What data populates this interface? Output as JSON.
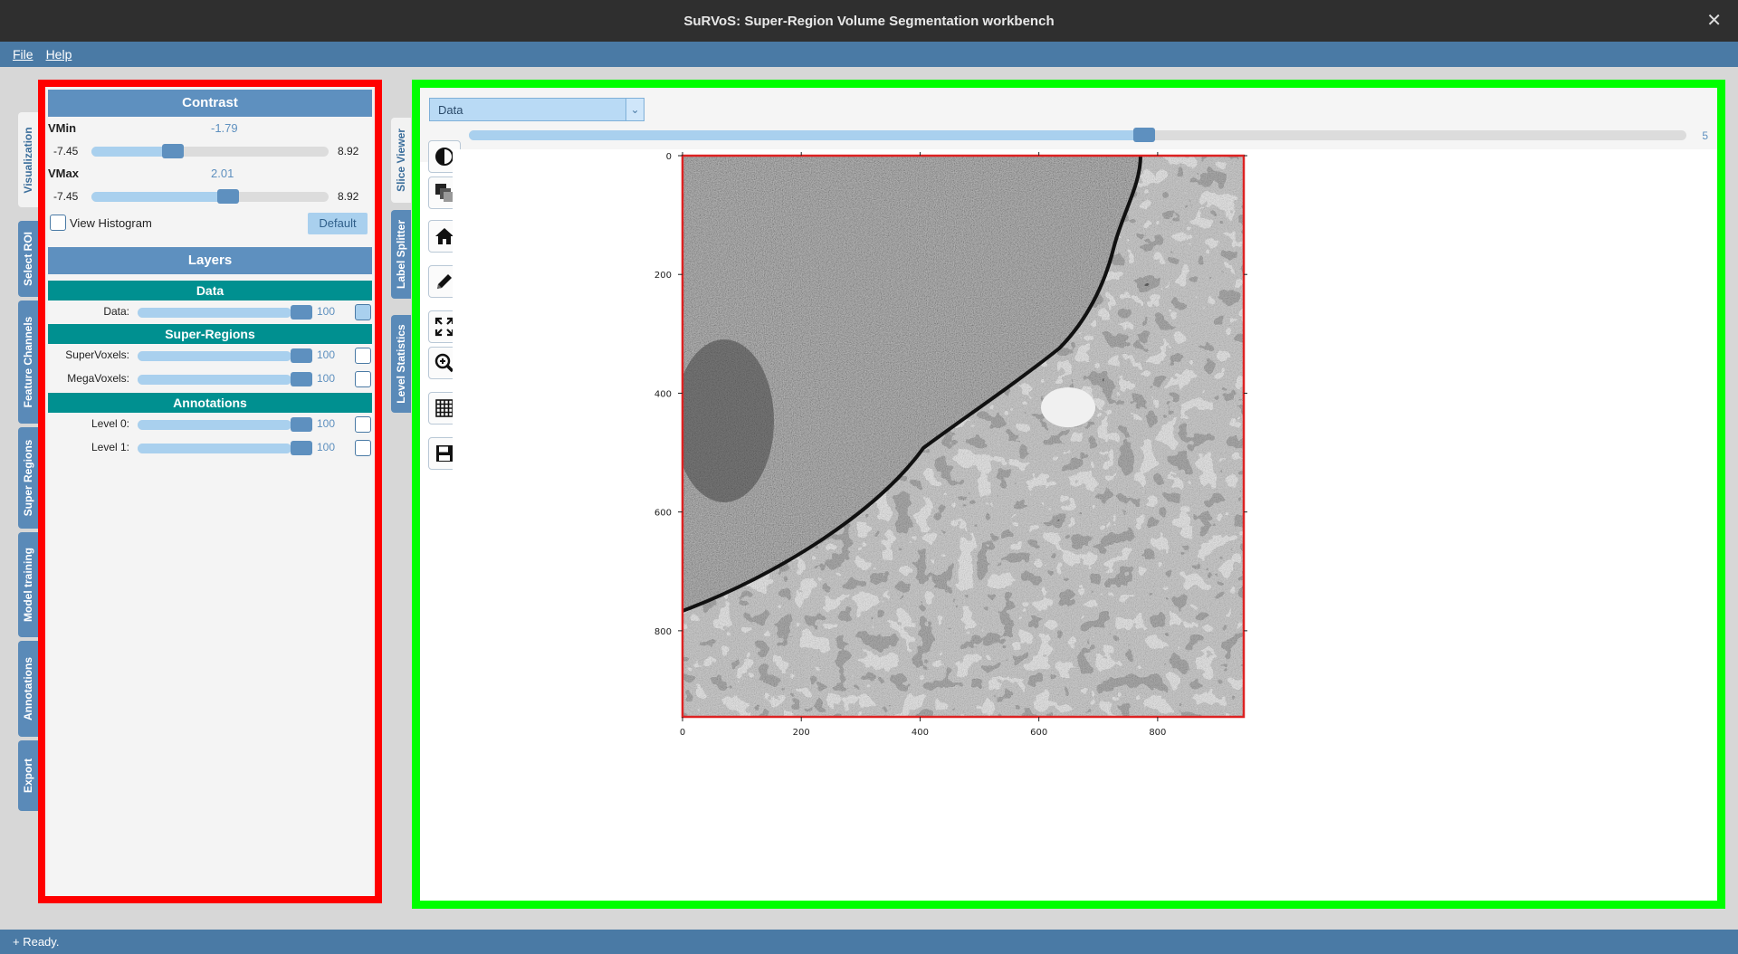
{
  "window": {
    "title": "SuRVoS: Super-Region Volume Segmentation workbench",
    "close": "✕"
  },
  "menu": {
    "file": "File",
    "help": "Help"
  },
  "left_tabs": [
    "Visualization",
    "Select ROI",
    "Feature Channels",
    "Super Regions",
    "Model training",
    "Annotations",
    "Export"
  ],
  "viewer_tabs": [
    "Slice Viewer",
    "Label Splitter",
    "Level Statistics"
  ],
  "contrast": {
    "title": "Contrast",
    "vmin_label": "VMin",
    "vmin_value": "-1.79",
    "vmin_min": "-7.45",
    "vmin_max": "8.92",
    "vmin_fraction": 0.345,
    "vmax_label": "VMax",
    "vmax_value": "2.01",
    "vmax_min": "-7.45",
    "vmax_max": "8.92",
    "vmax_fraction": 0.577,
    "histogram_label": "View Histogram",
    "default_button": "Default"
  },
  "layers": {
    "title": "Layers",
    "data_header": "Data",
    "data_label": "Data:",
    "data_value": "100",
    "superregions_header": "Super-Regions",
    "supervoxels_label": "SuperVoxels:",
    "supervoxels_value": "100",
    "megavoxels_label": "MegaVoxels:",
    "megavoxels_value": "100",
    "annotations_header": "Annotations",
    "level0_label": "Level 0:",
    "level0_value": "100",
    "level1_label": "Level 1:",
    "level1_value": "100"
  },
  "viewer": {
    "dropdown_value": "Data",
    "slice_value": "5",
    "slice_fraction": 0.555,
    "tools": [
      "contrast-icon",
      "layers-icon",
      "home-icon",
      "pencil-icon",
      "fit-screen-icon",
      "zoom-icon",
      "grid-icon",
      "save-icon"
    ],
    "x_ticks": [
      "0",
      "200",
      "400",
      "600",
      "800"
    ],
    "y_ticks": [
      "0",
      "200",
      "400",
      "600",
      "800"
    ]
  },
  "status": {
    "text": "+ Ready."
  },
  "colors": {
    "accent": "#4a7aa5",
    "panel_header": "#5e90bf",
    "subheader": "#009090",
    "highlight_left": "#ff0000",
    "highlight_right": "#00ff00"
  }
}
